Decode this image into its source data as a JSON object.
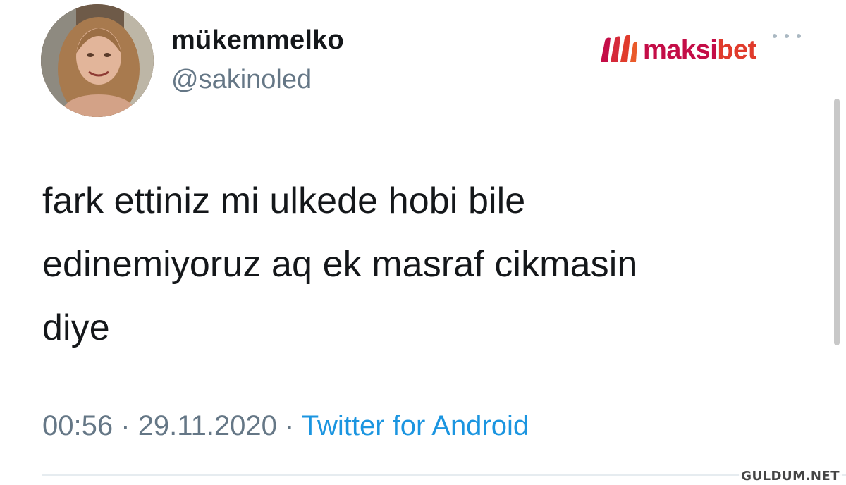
{
  "user": {
    "display_name": "mükemmelko",
    "handle": "@sakinoled"
  },
  "brand": {
    "name_part1": "maksi",
    "name_part2": "bet",
    "color_primary": "#c40d47",
    "color_secondary": "#e03b2c"
  },
  "tweet": {
    "lines": [
      "fark ettiniz mi ulkede hobi bile",
      "edinemiyoruz aq ek masraf cikmasin",
      "diye"
    ],
    "time": "00:56",
    "separator": "·",
    "date": "29.11.2020",
    "source": "Twitter for Android"
  },
  "watermark": "GULDUM.NET",
  "icons": {
    "more": "more-dots-icon",
    "brand_mark": "maksibet-logo-icon"
  },
  "colors": {
    "text": "#14171a",
    "secondary_text": "#657786",
    "link": "#1b95e0"
  }
}
